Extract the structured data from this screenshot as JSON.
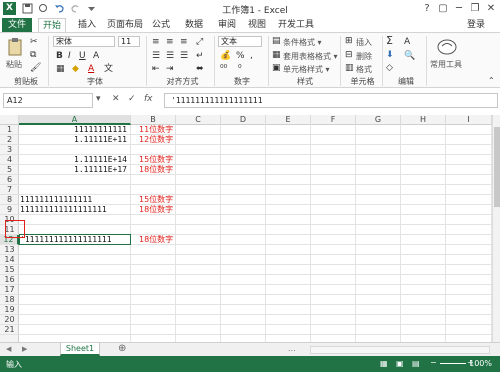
{
  "window": {
    "title": "工作簿1 - Excel",
    "app_logo": "X",
    "controls": [
      "?",
      "▢",
      "─",
      "❐",
      "✕"
    ]
  },
  "tabs": {
    "file": "文件",
    "home": "开始",
    "insert": "插入",
    "page_layout": "页面布局",
    "formulas": "公式",
    "data": "数据",
    "review": "审阅",
    "view": "视图",
    "developer": "开发工具",
    "login": "登录"
  },
  "ribbon": {
    "clipboard": {
      "label": "剪贴板",
      "paste": "粘贴"
    },
    "font": {
      "label": "字体",
      "font_name": "宋体",
      "font_size": "11"
    },
    "alignment": {
      "label": "对齐方式"
    },
    "number": {
      "label": "数字",
      "format": "文本",
      "percent": "%"
    },
    "styles": {
      "label": "样式",
      "conditional": "条件格式 ▾",
      "table": "套用表格格式 ▾",
      "cell_styles": "单元格样式 ▾"
    },
    "cells": {
      "label": "单元格",
      "insert": "插入",
      "delete": "删除",
      "format": "格式"
    },
    "editing": {
      "label": "编辑",
      "sum": "Σ",
      "sort": "A",
      "find": "🔍"
    },
    "common_tools": {
      "label": "常用工具"
    }
  },
  "formula_bar": {
    "name_box": "A12",
    "cancel_icon": "✕",
    "enter_icon": "✓",
    "fx": "fx",
    "value": "'111111111111111111"
  },
  "columns": [
    "A",
    "B",
    "C",
    "D",
    "E",
    "F",
    "G",
    "H",
    "I"
  ],
  "rows": [
    "1",
    "2",
    "3",
    "4",
    "5",
    "6",
    "7",
    "8",
    "9",
    "10",
    "11",
    "12",
    "13",
    "14",
    "15",
    "16",
    "17",
    "18",
    "19",
    "20",
    "21"
  ],
  "cells": {
    "A1": "11111111111",
    "B1": "11位数字",
    "A2": "1.11111E+11",
    "B2": "12位数字",
    "A4": "1.11111E+14",
    "B4": "15位数字",
    "A5": "1.11111E+17",
    "B5": "18位数字",
    "A8": "111111111111111",
    "B8": "15位数字",
    "A9": "111111111111111111",
    "B9": "18位数字",
    "A12": "'111111111111111111",
    "B12": "18位数字"
  },
  "sheets": {
    "active": "Sheet1",
    "add_icon": "⊕",
    "nav_prev": "◀",
    "nav_next": "▶",
    "more": "..."
  },
  "status": {
    "mode": "输入",
    "zoom": "100%"
  },
  "colors": {
    "accent": "#217346",
    "red_text": "#e0211c"
  }
}
